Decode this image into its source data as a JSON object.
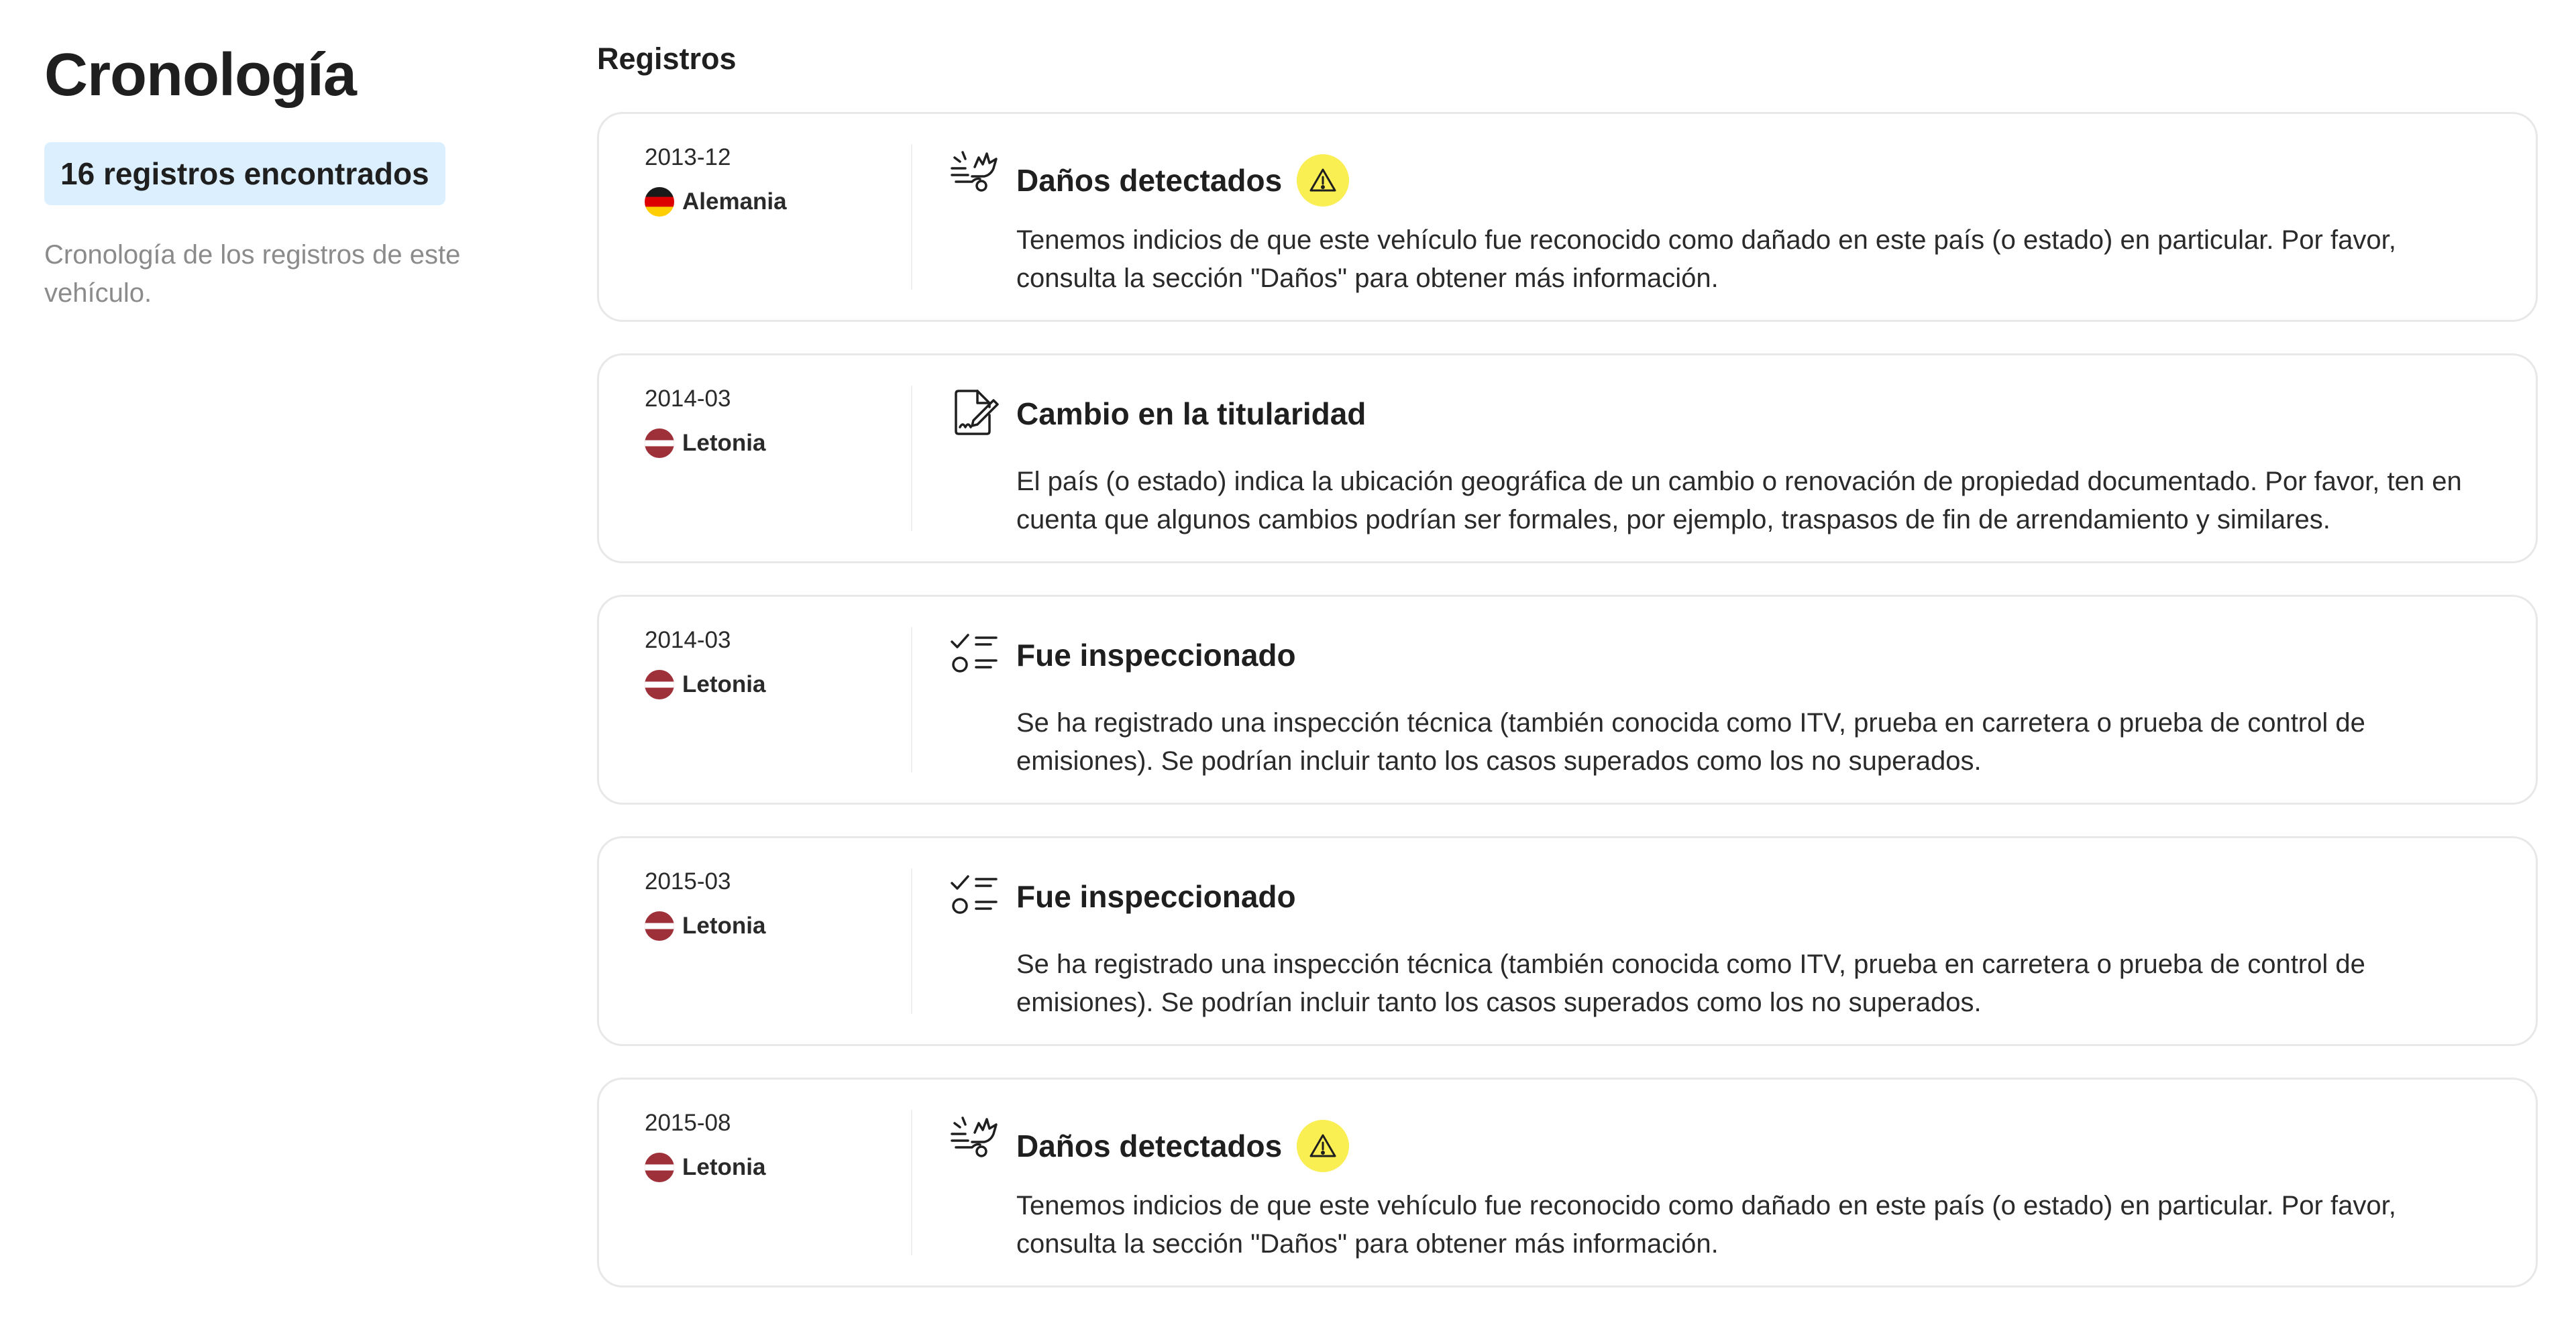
{
  "timeline": {
    "title": "Cronología",
    "count_label": "16 registros encontrados",
    "description": "Cronología de los registros de este vehículo."
  },
  "records_section": {
    "title": "Registros",
    "items": [
      {
        "date": "2013-12",
        "country": "Alemania",
        "flag": "germany-flag",
        "icon": "damage-icon",
        "title": "Daños detectados",
        "warning": true,
        "text": "Tenemos indicios de que este vehículo fue reconocido como dañado en este país (o estado) en particular. Por favor, consulta la sección \"Daños\" para obtener más información."
      },
      {
        "date": "2014-03",
        "country": "Letonia",
        "flag": "latvia-flag",
        "icon": "ownership-document-icon",
        "title": "Cambio en la titularidad",
        "warning": false,
        "text": "El país (o estado) indica la ubicación geográfica de un cambio o renovación de propiedad documentado. Por favor, ten en cuenta que algunos cambios podrían ser formales, por ejemplo, traspasos de fin de arrendamiento y similares."
      },
      {
        "date": "2014-03",
        "country": "Letonia",
        "flag": "latvia-flag",
        "icon": "checklist-icon",
        "title": "Fue inspeccionado",
        "warning": false,
        "text": "Se ha registrado una inspección técnica (también conocida como ITV, prueba en carretera o prueba de control de emisiones). Se podrían incluir tanto los casos superados como los no superados."
      },
      {
        "date": "2015-03",
        "country": "Letonia",
        "flag": "latvia-flag",
        "icon": "checklist-icon",
        "title": "Fue inspeccionado",
        "warning": false,
        "text": "Se ha registrado una inspección técnica (también conocida como ITV, prueba en carretera o prueba de control de emisiones). Se podrían incluir tanto los casos superados como los no superados."
      },
      {
        "date": "2015-08",
        "country": "Letonia",
        "flag": "latvia-flag",
        "icon": "damage-icon",
        "title": "Daños detectados",
        "warning": true,
        "text": "Tenemos indicios de que este vehículo fue reconocido como dañado en este país (o estado) en particular. Por favor, consulta la sección \"Daños\" para obtener más información."
      }
    ]
  },
  "colors": {
    "badge_bg": "#dbefff",
    "warning_yellow": "#f9ee52",
    "latvia_red": "#9e3039",
    "card_border": "#e8e8e8",
    "muted_text": "#8b8b8b"
  }
}
